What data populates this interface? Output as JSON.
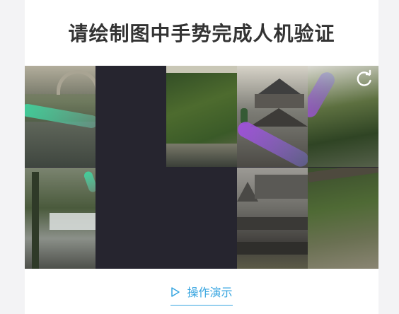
{
  "captcha": {
    "title": "请绘制图中手势完成人机验证",
    "demo_icon": "play-triangle-icon",
    "demo_label": "操作演示",
    "refresh_icon": "refresh-icon"
  },
  "colors": {
    "title": "#333333",
    "accent": "#37a5e0",
    "blank_tile": "#26252f"
  }
}
